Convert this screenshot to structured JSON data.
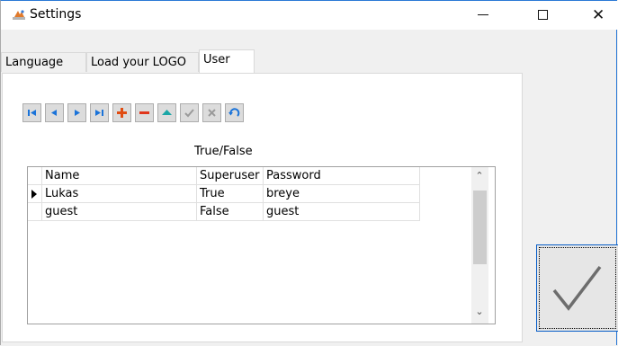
{
  "window": {
    "title": "Settings"
  },
  "tabs": [
    {
      "label": "Language"
    },
    {
      "label": "Load your LOGO"
    },
    {
      "label": "User"
    }
  ],
  "toolbar": {
    "buttons": [
      {
        "icon": "first-record-icon"
      },
      {
        "icon": "prior-record-icon"
      },
      {
        "icon": "next-record-icon"
      },
      {
        "icon": "last-record-icon"
      },
      {
        "icon": "insert-record-icon"
      },
      {
        "icon": "delete-record-icon"
      },
      {
        "icon": "edit-record-icon"
      },
      {
        "icon": "post-record-icon"
      },
      {
        "icon": "cancel-edit-icon"
      },
      {
        "icon": "refresh-icon"
      }
    ]
  },
  "user_panel": {
    "hint": "True/False",
    "columns": [
      "Name",
      "Superuser",
      "Password"
    ],
    "rows": [
      {
        "name": "Lukas",
        "superuser": "True",
        "password": "breye",
        "current": true
      },
      {
        "name": "guest",
        "superuser": "False",
        "password": "guest",
        "current": false
      }
    ]
  },
  "colors": {
    "nav_blue": "#1a73d9",
    "insert_orange": "#e04c12",
    "delete_red": "#e0361c",
    "edit_teal": "#1aa6a6",
    "disabled_gray": "#9a9a9a",
    "accent_border": "#0a5fc8"
  }
}
